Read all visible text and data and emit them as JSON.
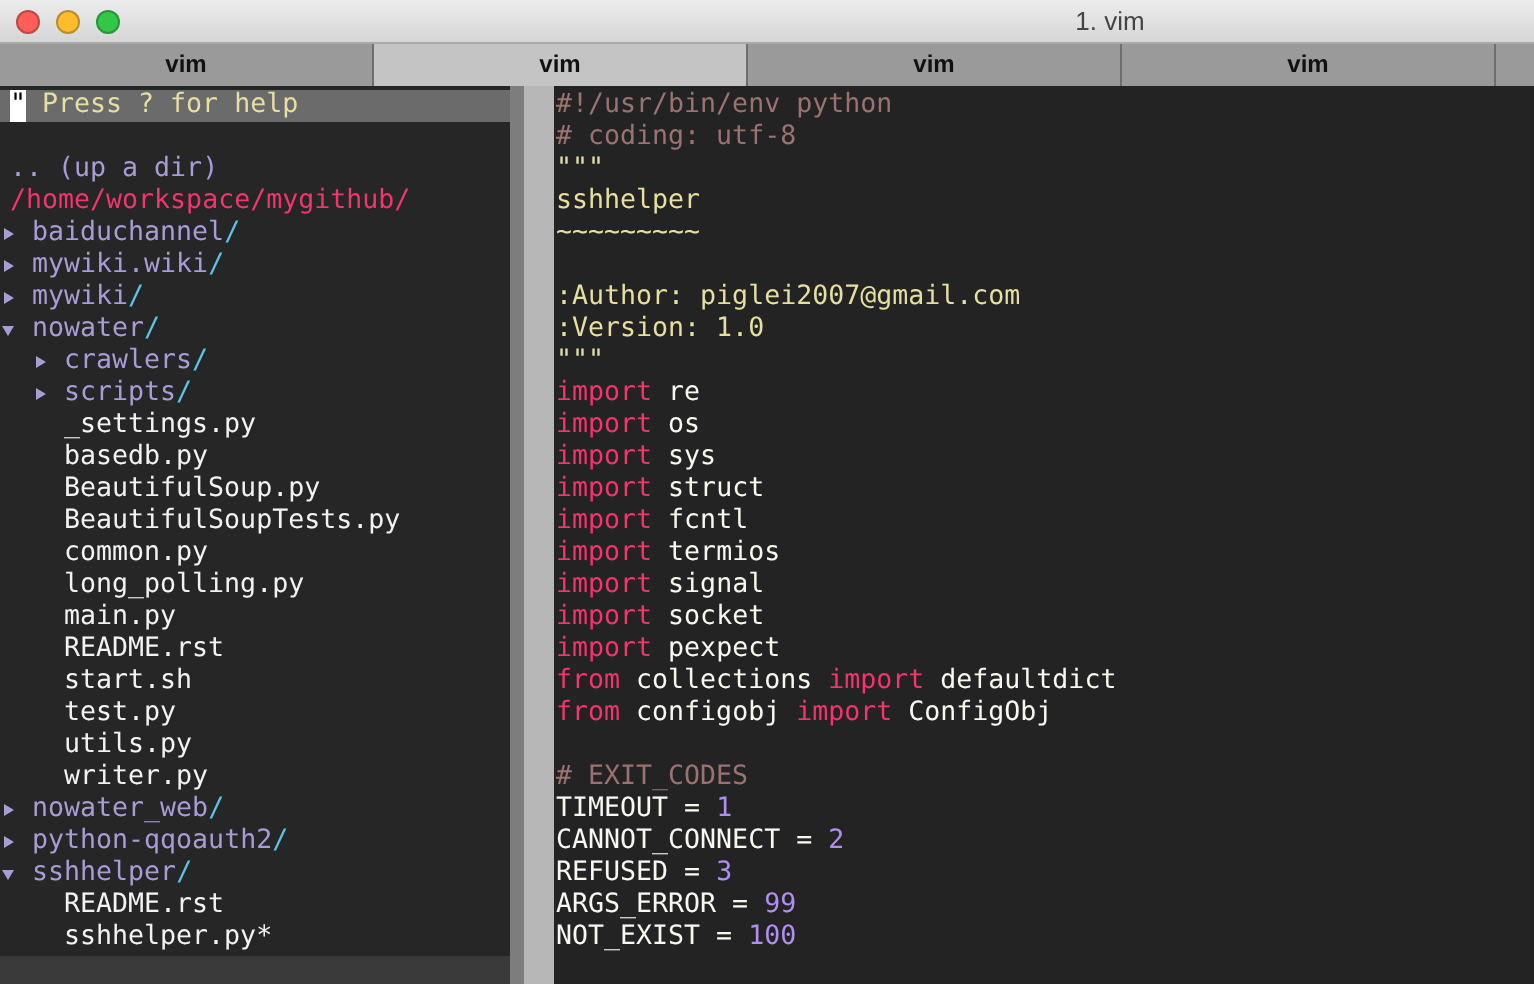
{
  "window": {
    "title": "1. vim"
  },
  "tabs": [
    {
      "label": "vim",
      "selected": false
    },
    {
      "label": "vim",
      "selected": true
    },
    {
      "label": "vim",
      "selected": false
    },
    {
      "label": "vim",
      "selected": false
    }
  ],
  "tree": {
    "help_mark": "\"",
    "help": "Press ? for help",
    "up": ".. (up a dir)",
    "root": "/home/workspace/mygithub/",
    "items": [
      {
        "kind": "dir",
        "name": "baiduchannel",
        "slash": "/",
        "expanded": false
      },
      {
        "kind": "dir",
        "name": "mywiki.wiki",
        "slash": "/",
        "expanded": false
      },
      {
        "kind": "dir",
        "name": "mywiki",
        "slash": "/",
        "expanded": false
      },
      {
        "kind": "dir",
        "name": "nowater",
        "slash": "/",
        "expanded": true,
        "children": [
          {
            "kind": "dir",
            "name": "crawlers",
            "slash": "/",
            "expanded": false
          },
          {
            "kind": "dir",
            "name": "scripts",
            "slash": "/",
            "expanded": false
          },
          {
            "kind": "file",
            "name": "_settings.py"
          },
          {
            "kind": "file",
            "name": "basedb.py"
          },
          {
            "kind": "file",
            "name": "BeautifulSoup.py"
          },
          {
            "kind": "file",
            "name": "BeautifulSoupTests.py"
          },
          {
            "kind": "file",
            "name": "common.py"
          },
          {
            "kind": "file",
            "name": "long_polling.py"
          },
          {
            "kind": "file",
            "name": "main.py"
          },
          {
            "kind": "file",
            "name": "README.rst"
          },
          {
            "kind": "file",
            "name": "start.sh"
          },
          {
            "kind": "file",
            "name": "test.py"
          },
          {
            "kind": "file",
            "name": "utils.py"
          },
          {
            "kind": "file",
            "name": "writer.py"
          }
        ]
      },
      {
        "kind": "dir",
        "name": "nowater_web",
        "slash": "/",
        "expanded": false
      },
      {
        "kind": "dir",
        "name": "python-qqoauth2",
        "slash": "/",
        "expanded": false
      },
      {
        "kind": "dir",
        "name": "sshhelper",
        "slash": "/",
        "expanded": true,
        "children": [
          {
            "kind": "file",
            "name": "README.rst"
          },
          {
            "kind": "file",
            "name": "sshhelper.py*"
          }
        ]
      }
    ]
  },
  "code_blocks": [
    {
      "lines": [
        [
          {
            "kind": "comment",
            "text": "#!/usr/bin/env python"
          }
        ],
        [
          {
            "kind": "comment",
            "text": "# coding: utf-8"
          }
        ],
        [
          {
            "kind": "string",
            "text": "\"\"\""
          }
        ],
        [
          {
            "kind": "string",
            "text": "sshhelper"
          }
        ],
        [
          {
            "kind": "string",
            "text": "~~~~~~~~~"
          }
        ]
      ]
    },
    {
      "lines": [
        [
          {
            "kind": "string",
            "text": ":Author: piglei2007@gmail.com"
          }
        ],
        [
          {
            "kind": "string",
            "text": ":Version: 1.0"
          }
        ],
        [
          {
            "kind": "string",
            "text": "\"\"\""
          }
        ],
        [
          {
            "kind": "keyword",
            "text": "import"
          },
          {
            "kind": "plain",
            "text": "re"
          }
        ],
        [
          {
            "kind": "keyword",
            "text": "import"
          },
          {
            "kind": "plain",
            "text": "os"
          }
        ],
        [
          {
            "kind": "keyword",
            "text": "import"
          },
          {
            "kind": "plain",
            "text": "sys"
          }
        ],
        [
          {
            "kind": "keyword",
            "text": "import"
          },
          {
            "kind": "plain",
            "text": "struct"
          }
        ],
        [
          {
            "kind": "keyword",
            "text": "import"
          },
          {
            "kind": "plain",
            "text": "fcntl"
          }
        ],
        [
          {
            "kind": "keyword",
            "text": "import"
          },
          {
            "kind": "plain",
            "text": "termios"
          }
        ],
        [
          {
            "kind": "keyword",
            "text": "import"
          },
          {
            "kind": "plain",
            "text": "signal"
          }
        ],
        [
          {
            "kind": "keyword",
            "text": "import"
          },
          {
            "kind": "plain",
            "text": "socket"
          }
        ],
        [
          {
            "kind": "keyword",
            "text": "import"
          },
          {
            "kind": "plain",
            "text": "pexpect"
          }
        ],
        [
          {
            "kind": "keyword",
            "text": "from"
          },
          {
            "kind": "plain",
            "text": "collections"
          },
          {
            "kind": "keyword",
            "text": "import"
          },
          {
            "kind": "plain",
            "text": "defaultdict"
          }
        ],
        [
          {
            "kind": "keyword",
            "text": "from"
          },
          {
            "kind": "plain",
            "text": "configobj"
          },
          {
            "kind": "keyword",
            "text": "import"
          },
          {
            "kind": "plain",
            "text": "ConfigObj"
          }
        ]
      ]
    },
    {
      "lines": [
        [
          {
            "kind": "comment",
            "text": "# EXIT_CODES"
          }
        ],
        [
          {
            "kind": "plain",
            "text": "TIMEOUT ="
          },
          {
            "kind": "number",
            "text": "1"
          }
        ],
        [
          {
            "kind": "plain",
            "text": "CANNOT_CONNECT ="
          },
          {
            "kind": "number",
            "text": "2"
          }
        ],
        [
          {
            "kind": "plain",
            "text": "REFUSED ="
          },
          {
            "kind": "number",
            "text": "3"
          }
        ],
        [
          {
            "kind": "plain",
            "text": "ARGS_ERROR ="
          },
          {
            "kind": "number",
            "text": "99"
          }
        ],
        [
          {
            "kind": "plain",
            "text": "NOT_EXIST ="
          },
          {
            "kind": "number",
            "text": "100"
          }
        ]
      ]
    }
  ]
}
